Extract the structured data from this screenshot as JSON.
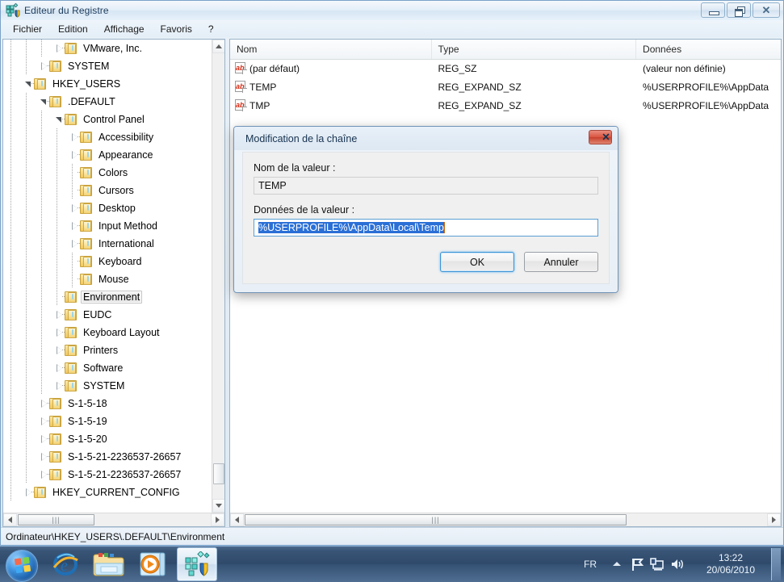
{
  "window": {
    "title": "Editeur du Registre",
    "icon": "regedit-icon",
    "caption": {
      "minimize": "minimize-button",
      "restore": "restore-button",
      "close": "close-button",
      "close_glyph": "✕"
    },
    "menu": [
      "Fichier",
      "Edition",
      "Affichage",
      "Favoris",
      "?"
    ],
    "statusbar": "Ordinateur\\HKEY_USERS\\.DEFAULT\\Environment"
  },
  "tree": {
    "nodes": [
      {
        "label": "VMware, Inc.",
        "depth": 4,
        "state": "collapsed",
        "selected": false
      },
      {
        "label": "SYSTEM",
        "depth": 3,
        "state": "collapsed",
        "selected": false
      },
      {
        "label": "HKEY_USERS",
        "depth": 2,
        "state": "expanded",
        "selected": false
      },
      {
        "label": ".DEFAULT",
        "depth": 3,
        "state": "expanded",
        "selected": false
      },
      {
        "label": "Control Panel",
        "depth": 4,
        "state": "expanded",
        "selected": false
      },
      {
        "label": "Accessibility",
        "depth": 5,
        "state": "collapsed",
        "selected": false
      },
      {
        "label": "Appearance",
        "depth": 5,
        "state": "collapsed",
        "selected": false
      },
      {
        "label": "Colors",
        "depth": 5,
        "state": "leaf",
        "selected": false
      },
      {
        "label": "Cursors",
        "depth": 5,
        "state": "leaf",
        "selected": false
      },
      {
        "label": "Desktop",
        "depth": 5,
        "state": "collapsed",
        "selected": false
      },
      {
        "label": "Input Method",
        "depth": 5,
        "state": "collapsed",
        "selected": false
      },
      {
        "label": "International",
        "depth": 5,
        "state": "collapsed",
        "selected": false
      },
      {
        "label": "Keyboard",
        "depth": 5,
        "state": "leaf",
        "selected": false
      },
      {
        "label": "Mouse",
        "depth": 5,
        "state": "leaf",
        "selected": false
      },
      {
        "label": "Environment",
        "depth": 4,
        "state": "leaf",
        "selected": true
      },
      {
        "label": "EUDC",
        "depth": 4,
        "state": "collapsed",
        "selected": false
      },
      {
        "label": "Keyboard Layout",
        "depth": 4,
        "state": "collapsed",
        "selected": false
      },
      {
        "label": "Printers",
        "depth": 4,
        "state": "collapsed",
        "selected": false
      },
      {
        "label": "Software",
        "depth": 4,
        "state": "collapsed",
        "selected": false
      },
      {
        "label": "SYSTEM",
        "depth": 4,
        "state": "collapsed",
        "selected": false
      },
      {
        "label": "S-1-5-18",
        "depth": 3,
        "state": "collapsed",
        "selected": false
      },
      {
        "label": "S-1-5-19",
        "depth": 3,
        "state": "collapsed",
        "selected": false
      },
      {
        "label": "S-1-5-20",
        "depth": 3,
        "state": "collapsed",
        "selected": false
      },
      {
        "label": "S-1-5-21-2236537-26657",
        "depth": 3,
        "state": "collapsed",
        "selected": false
      },
      {
        "label": "S-1-5-21-2236537-26657",
        "depth": 3,
        "state": "collapsed",
        "selected": false
      },
      {
        "label": "HKEY_CURRENT_CONFIG",
        "depth": 2,
        "state": "collapsed",
        "selected": false
      }
    ]
  },
  "list": {
    "columns": [
      "Nom",
      "Type",
      "Données"
    ],
    "rows": [
      {
        "name": "(par défaut)",
        "type": "REG_SZ",
        "data": "(valeur non définie)"
      },
      {
        "name": "TEMP",
        "type": "REG_EXPAND_SZ",
        "data": "%USERPROFILE%\\AppData"
      },
      {
        "name": "TMP",
        "type": "REG_EXPAND_SZ",
        "data": "%USERPROFILE%\\AppData"
      }
    ]
  },
  "dialog": {
    "title": "Modification de la chaîne",
    "close_glyph": "✕",
    "name_label": "Nom de la valeur :",
    "name_value": "TEMP",
    "data_label": "Données de la valeur :",
    "data_value": "%USERPROFILE%\\AppData\\Local\\Temp",
    "ok": "OK",
    "cancel": "Annuler"
  },
  "taskbar": {
    "start": "start-orb",
    "buttons": [
      "internet-explorer",
      "windows-explorer",
      "windows-media-player",
      "registry-editor"
    ],
    "tray": {
      "language": "FR",
      "icons": [
        "show-hidden-icons",
        "action-center-flag",
        "network",
        "volume"
      ]
    },
    "clock": {
      "time": "13:22",
      "date": "20/06/2010"
    }
  },
  "colors": {
    "accent": "#3d94d6",
    "selection": "#2a6fd6",
    "folder": "#f3d277",
    "ab_red": "#d42a13",
    "desktop": "#3b6ea5"
  }
}
